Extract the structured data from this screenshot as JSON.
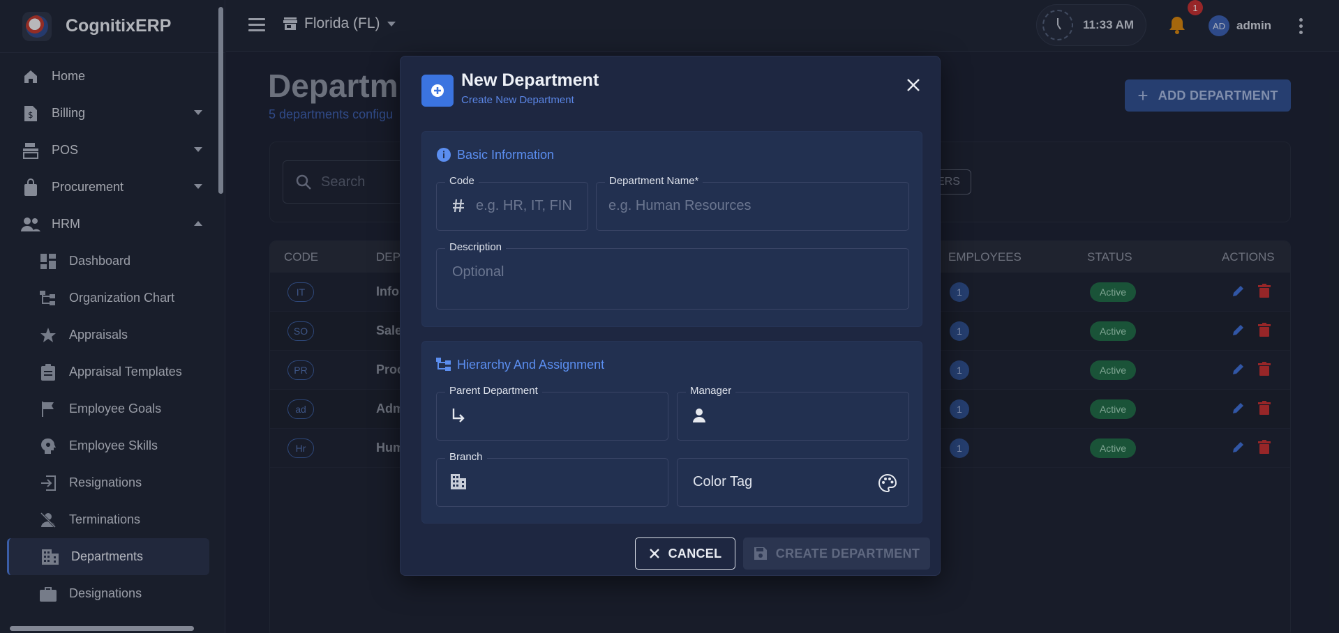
{
  "app": {
    "name": "CognitixERP"
  },
  "topbar": {
    "branch": "Florida (FL)",
    "time": "11:33 AM",
    "notifications_count": "1",
    "user_initials": "AD",
    "user_name": "admin"
  },
  "sidebar": {
    "items": [
      {
        "label": "Home",
        "icon": "home-icon"
      },
      {
        "label": "Billing",
        "icon": "billing-icon",
        "expandable": true
      },
      {
        "label": "POS",
        "icon": "pos-icon",
        "expandable": true
      },
      {
        "label": "Procurement",
        "icon": "bag-icon",
        "expandable": true
      },
      {
        "label": "HRM",
        "icon": "people-icon",
        "expanded": true
      }
    ],
    "hrm_items": [
      {
        "label": "Dashboard",
        "icon": "dashboard-icon"
      },
      {
        "label": "Organization Chart",
        "icon": "org-chart-icon"
      },
      {
        "label": "Appraisals",
        "icon": "star-icon"
      },
      {
        "label": "Appraisal Templates",
        "icon": "clipboard-icon"
      },
      {
        "label": "Employee Goals",
        "icon": "flag-icon"
      },
      {
        "label": "Employee Skills",
        "icon": "skills-icon"
      },
      {
        "label": "Resignations",
        "icon": "exit-icon"
      },
      {
        "label": "Terminations",
        "icon": "person-off-icon"
      },
      {
        "label": "Departments",
        "icon": "building-icon",
        "active": true
      },
      {
        "label": "Designations",
        "icon": "briefcase-icon"
      }
    ]
  },
  "page": {
    "title": "Departm",
    "subtitle": "5 departments configu",
    "add_button": "ADD DEPARTMENT",
    "search_placeholder": "Search",
    "filters_label": "ERS",
    "table": {
      "headers": {
        "code": "CODE",
        "department": "DEP",
        "employees": "EMPLOYEES",
        "status": "STATUS",
        "actions": "ACTIONS"
      },
      "rows": [
        {
          "code": "IT",
          "name": "Info",
          "employees": "1",
          "status": "Active"
        },
        {
          "code": "SO",
          "name": "Sale",
          "employees": "1",
          "status": "Active"
        },
        {
          "code": "PR",
          "name": "Proc",
          "employees": "1",
          "status": "Active"
        },
        {
          "code": "ad",
          "name": "Adm",
          "employees": "1",
          "status": "Active"
        },
        {
          "code": "Hr",
          "name": "Hum",
          "employees": "1",
          "status": "Active"
        }
      ]
    }
  },
  "modal": {
    "title": "New Department",
    "subtitle": "Create New Department",
    "basic_section": "Basic Information",
    "code_label": "Code",
    "code_placeholder": "e.g. HR, IT, FIN",
    "name_label": "Department Name*",
    "name_placeholder": "e.g. Human Resources",
    "description_label": "Description",
    "description_placeholder": "Optional",
    "hierarchy_section": "Hierarchy And Assignment",
    "parent_label": "Parent Department",
    "manager_label": "Manager",
    "branch_label": "Branch",
    "color_tag": "Color Tag",
    "cancel": "CANCEL",
    "create": "CREATE DEPARTMENT"
  },
  "colors": {
    "accent": "#3b74e0",
    "active_status": "#1f6b45",
    "delete": "#c62f2f"
  }
}
